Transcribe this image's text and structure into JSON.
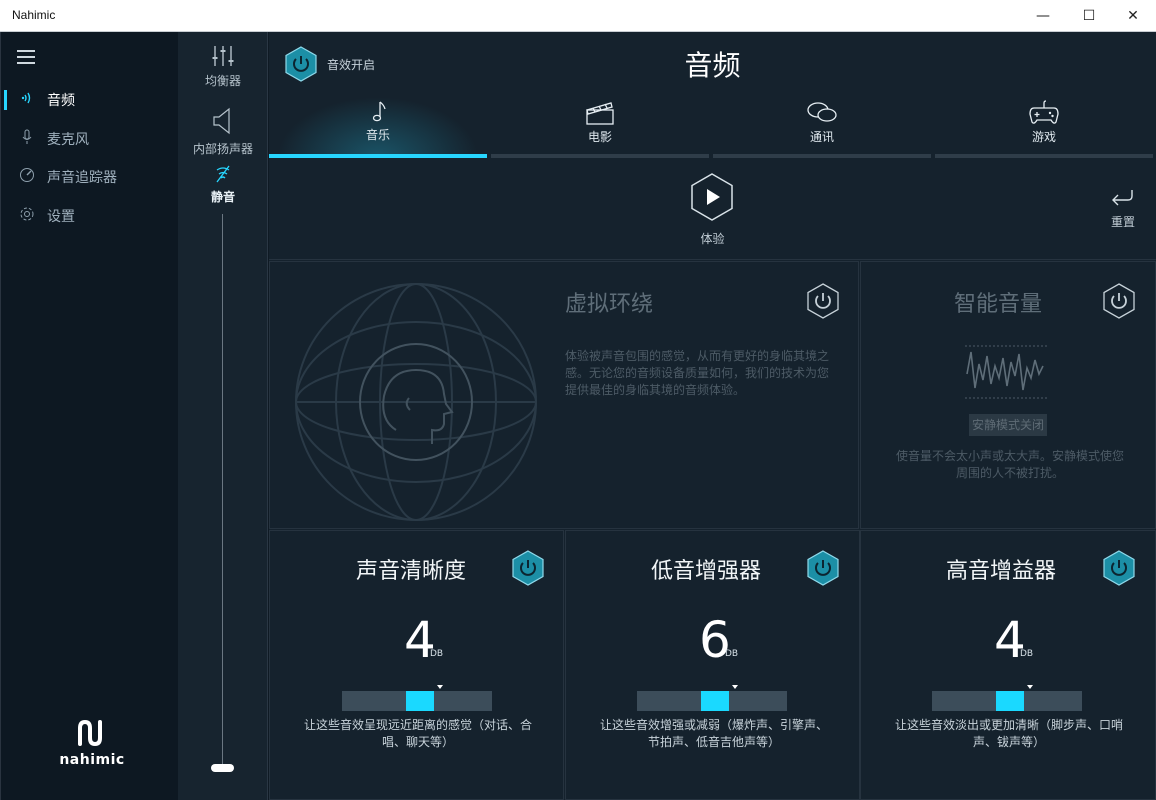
{
  "window": {
    "title": "Nahimic",
    "minimize": "—",
    "maximize": "☐",
    "close": "✕"
  },
  "leftnav": {
    "items": [
      {
        "label": "音频",
        "icon": "audio-wave-icon",
        "active": true
      },
      {
        "label": "麦克风",
        "icon": "microphone-icon",
        "active": false
      },
      {
        "label": "声音追踪器",
        "icon": "sound-tracker-icon",
        "active": false
      },
      {
        "label": "设置",
        "icon": "gear-icon",
        "active": false
      }
    ],
    "logo_text": "nahimic"
  },
  "sidecol": {
    "equalizer_label": "均衡器",
    "speaker_label": "内部扬声器",
    "mute_label": "静音",
    "volume_level": 0
  },
  "main": {
    "effects_label": "音效开启",
    "title": "音频",
    "tabs": [
      {
        "label": "音乐",
        "icon": "music-note-icon",
        "active": true
      },
      {
        "label": "电影",
        "icon": "clapperboard-icon",
        "active": false
      },
      {
        "label": "通讯",
        "icon": "chat-bubbles-icon",
        "active": false
      },
      {
        "label": "游戏",
        "icon": "gamepad-icon",
        "active": false
      }
    ],
    "play_label": "体验",
    "reset_label": "重置"
  },
  "virtual_surround": {
    "title": "虚拟环绕",
    "description": "体验被声音包围的感觉，从而有更好的身临其境之感。无论您的音频设备质量如何，我们的技术为您提供最佳的身临其境的音频体验。"
  },
  "smart_volume": {
    "title": "智能音量",
    "quiet_mode": "安静模式关闭",
    "description": "使音量不会太小声或太大声。安静模式使您周围的人不被打扰。"
  },
  "cards": [
    {
      "title": "声音清晰度",
      "value": "4",
      "unit": "DB",
      "level": 0.5,
      "description": "让这些音效呈现远近距离的感觉（对话、合唱、聊天等）"
    },
    {
      "title": "低音增强器",
      "value": "6",
      "unit": "DB",
      "level": 0.5,
      "description": "让这些音效增强或减弱（爆炸声、引擎声、节拍声、低音吉他声等）"
    },
    {
      "title": "高音增益器",
      "value": "4",
      "unit": "DB",
      "level": 0.5,
      "description": "让这些音效淡出或更加清晰（脚步声、口哨声、钹声等）"
    }
  ],
  "colors": {
    "accent": "#27d6ff",
    "background": "#15222d",
    "nav": "#0d1822"
  }
}
